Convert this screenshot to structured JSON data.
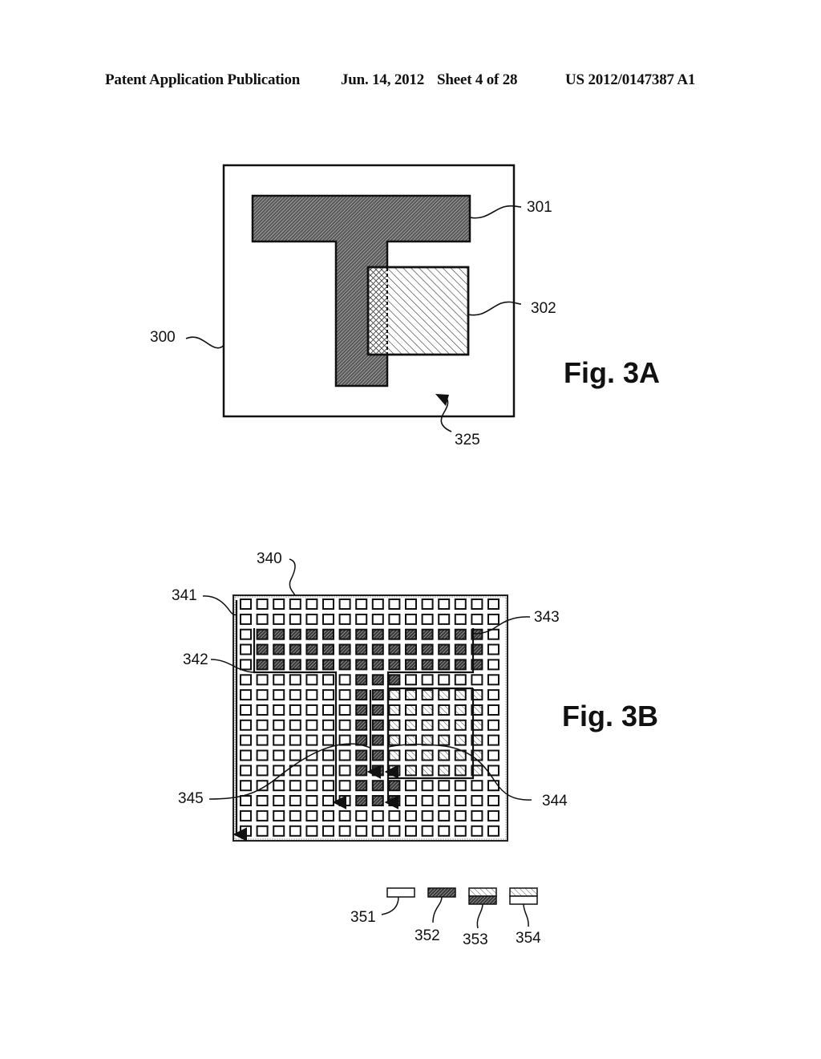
{
  "header": {
    "left": "Patent Application Publication",
    "date": "Jun. 14, 2012",
    "sheet": "Sheet 4 of 28",
    "number": "US 2012/0147387 A1"
  },
  "fig3a": {
    "title": "Fig. 3A",
    "labels": {
      "frame": "300",
      "t_shape": "301",
      "square": "302",
      "background": "325"
    }
  },
  "fig3b": {
    "title": "Fig. 3B",
    "labels": {
      "grid": "340",
      "scan_path": "341",
      "path_342": "342",
      "path_343": "343",
      "path_344": "344",
      "path_345": "345"
    },
    "grid": {
      "rows": 16,
      "cols": 16,
      "legend_key": {
        "w": "351 empty",
        "d": "352 object 301",
        "o": "353 overlap 301+302",
        "l": "354 object 302"
      },
      "cells": [
        "wwwwwwwwwwwwwwww",
        "wwwwwwwwwwwwwwww",
        "wddddddddddddddw",
        "wddddddddddddddw",
        "wddddddddddddddw",
        "wwwwwwwdddwwwwww",
        "wwwwwwwddolllllw",
        "wwwwwwwddolllllw",
        "wwwwwwwddolllllw",
        "wwwwwwwddolllllw",
        "wwwwwwwddolllllw",
        "wwwwwwwddolllllw",
        "wwwwwwwdddwwwwww",
        "wwwwwwwdddwwwwww",
        "wwwwwwwwwwwwwwww",
        "wwwwwwwwwwwwwwww"
      ]
    }
  },
  "legend": [
    {
      "id": "351",
      "type": "empty"
    },
    {
      "id": "352",
      "type": "dense-hatch"
    },
    {
      "id": "353",
      "type": "light-over-dense"
    },
    {
      "id": "354",
      "type": "light-over-empty"
    }
  ]
}
